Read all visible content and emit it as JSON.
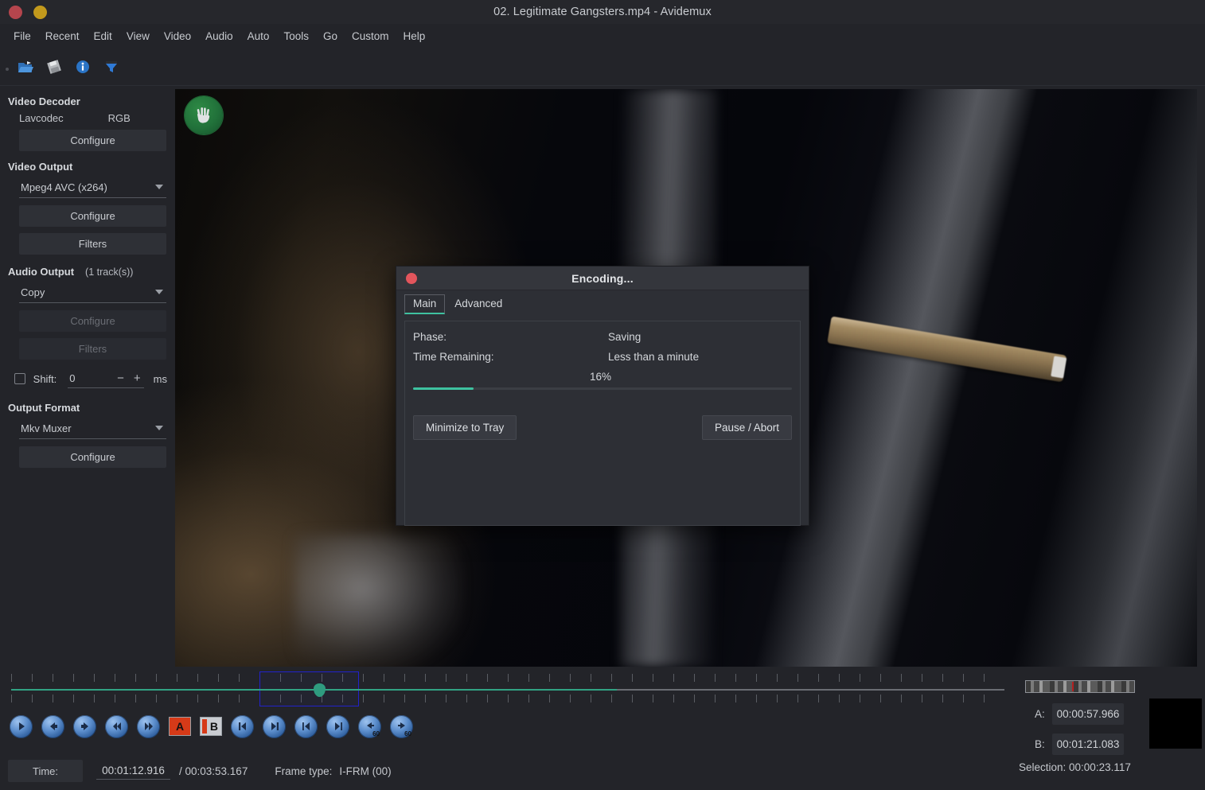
{
  "window": {
    "title": "02. Legitimate Gangsters.mp4 - Avidemux",
    "close_label": "",
    "minimize_label": ""
  },
  "menubar": {
    "items": [
      {
        "label": "File"
      },
      {
        "label": "Recent"
      },
      {
        "label": "Edit"
      },
      {
        "label": "View"
      },
      {
        "label": "Video"
      },
      {
        "label": "Audio"
      },
      {
        "label": "Auto"
      },
      {
        "label": "Tools"
      },
      {
        "label": "Go"
      },
      {
        "label": "Custom"
      },
      {
        "label": "Help"
      }
    ]
  },
  "toolbar": {
    "buttons": [
      {
        "icon": "open-file-icon",
        "label": "Open"
      },
      {
        "icon": "save-file-icon",
        "label": "Save"
      },
      {
        "icon": "info-icon",
        "label": "Information"
      },
      {
        "icon": "filter-funnel-icon",
        "label": "Filters"
      }
    ]
  },
  "sidebar": {
    "video_decoder": {
      "title": "Video Decoder",
      "codec": "Lavcodec",
      "colorspace": "RGB",
      "configure_label": "Configure"
    },
    "video_output": {
      "title": "Video Output",
      "selected": "Mpeg4 AVC (x264)",
      "configure_label": "Configure",
      "filters_label": "Filters"
    },
    "audio_output": {
      "title": "Audio Output",
      "tracks": "(1 track(s))",
      "selected": "Copy",
      "configure_label": "Configure",
      "filters_label": "Filters",
      "shift_label": "Shift:",
      "shift_value": "0",
      "shift_minus": "−",
      "shift_plus": "+",
      "shift_unit": "ms"
    },
    "output_format": {
      "title": "Output Format",
      "selected": "Mkv Muxer",
      "configure_label": "Configure"
    }
  },
  "dialog": {
    "title": "Encoding...",
    "tabs": [
      {
        "label": "Main",
        "active": true
      },
      {
        "label": "Advanced",
        "active": false
      }
    ],
    "phase_label": "Phase:",
    "phase_value": "Saving",
    "time_remaining_label": "Time Remaining:",
    "time_remaining_value": "Less than a minute",
    "percent_text": "16%",
    "percent_value": 16,
    "minimize_label": "Minimize to Tray",
    "pause_abort_label": "Pause / Abort",
    "accent_color": "#3ec2a0"
  },
  "timeline": {
    "progress_percent": 61,
    "thumb_percent": 31,
    "selection_start_percent": 25,
    "selection_end_percent": 35
  },
  "playback": {
    "buttons": [
      {
        "name": "play-button",
        "icon": "play-icon"
      },
      {
        "name": "previous-frame-button",
        "icon": "arrow-left-icon"
      },
      {
        "name": "next-frame-button",
        "icon": "arrow-right-icon"
      },
      {
        "name": "rewind-button",
        "icon": "double-arrow-left-icon"
      },
      {
        "name": "forward-button",
        "icon": "double-arrow-right-icon"
      },
      {
        "name": "marker-a-button",
        "icon": "marker-a-icon",
        "text": "A"
      },
      {
        "name": "marker-b-button",
        "icon": "marker-b-icon",
        "text": "B"
      },
      {
        "name": "previous-keyframe-button",
        "icon": "prev-keyframe-icon"
      },
      {
        "name": "next-keyframe-button",
        "icon": "next-keyframe-icon"
      },
      {
        "name": "previous-blackframe-button",
        "icon": "prev-black-frame-icon"
      },
      {
        "name": "next-blackframe-button",
        "icon": "next-black-frame-icon"
      },
      {
        "name": "back-60s-button",
        "icon": "back-60s-icon",
        "text": "60"
      },
      {
        "name": "forward-60s-button",
        "icon": "forward-60s-icon",
        "text": "60"
      }
    ]
  },
  "status": {
    "time_label": "Time:",
    "current_time": "00:01:12.916",
    "total_time": "/ 00:03:53.167",
    "frame_type_label": "Frame type:",
    "frame_type_value": "I-FRM (00)"
  },
  "markers": {
    "a_label": "A:",
    "a_value": "00:00:57.966",
    "b_label": "B:",
    "b_value": "00:01:21.083",
    "selection_text": "Selection: 00:00:23.117"
  }
}
